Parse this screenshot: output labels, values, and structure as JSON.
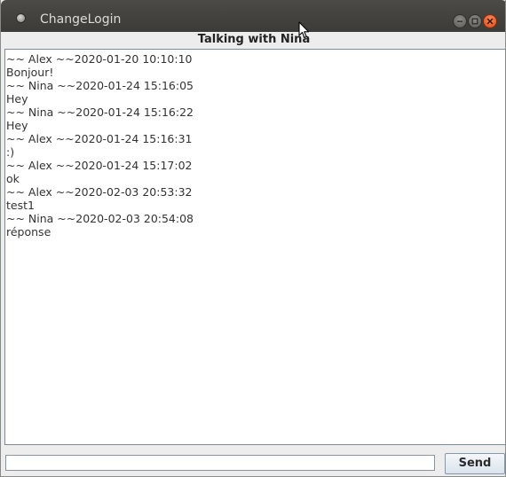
{
  "window": {
    "title": "ChangeLogin"
  },
  "chat": {
    "heading": "Talking with Nina",
    "lines": [
      "~~ Alex ~~2020-01-20 10:10:10",
      "Bonjour!",
      "~~ Nina ~~2020-01-24 15:16:05",
      "Hey",
      "~~ Nina ~~2020-01-24 15:16:22",
      "Hey",
      "~~ Alex ~~2020-01-24 15:16:31",
      ":)",
      "~~ Alex ~~2020-01-24 15:17:02",
      "ok",
      "~~ Alex ~~2020-02-03 20:53:32",
      "test1",
      "~~ Nina ~~2020-02-03 20:54:08",
      "réponse"
    ]
  },
  "composer": {
    "input_value": "",
    "send_label": "Send"
  },
  "colors": {
    "titlebar": "#3c3b37",
    "close_button": "#df4a16",
    "window_bg": "#ededed"
  },
  "icons": [
    "app-icon",
    "minimize-icon",
    "maximize-icon",
    "close-icon",
    "mouse-cursor-icon"
  ]
}
